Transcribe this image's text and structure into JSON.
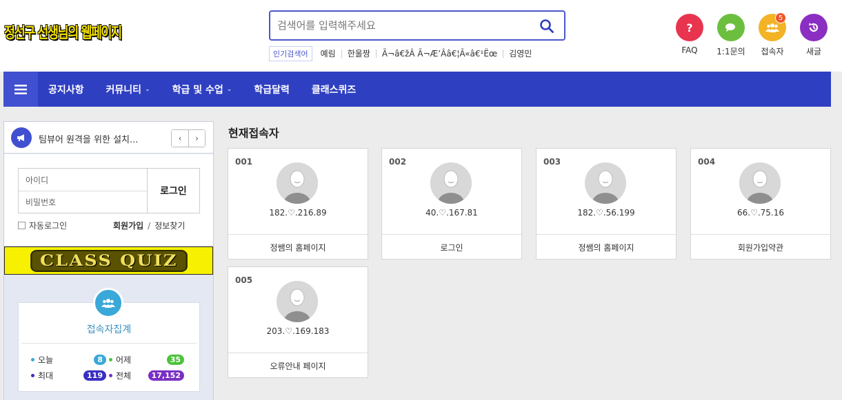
{
  "header": {
    "logo_text": "정선구 선생님의 웹페이지",
    "search": {
      "placeholder": "검색어를 입력해주세요"
    },
    "popular": {
      "tag_label": "인기검색어",
      "keywords": [
        "예림",
        "한울짱",
        "Ã¬â€žÂ Ã¬Æ’Ââ€¦Ã«â€¹Ëœ",
        "김영민"
      ]
    },
    "icons": [
      {
        "label": "FAQ",
        "icon": "question-icon",
        "color": "#e8344f"
      },
      {
        "label": "1:1문의",
        "icon": "chat-icon",
        "color": "#6cbf3e"
      },
      {
        "label": "접속자",
        "icon": "users-icon",
        "color": "#f3b325",
        "badge": "5"
      },
      {
        "label": "새글",
        "icon": "refresh-icon",
        "color": "#8a2fc2"
      }
    ]
  },
  "nav": {
    "items": [
      {
        "label": "공지사항",
        "dropdown": false
      },
      {
        "label": "커뮤니티",
        "dropdown": true
      },
      {
        "label": "학급 및 수업",
        "dropdown": true
      },
      {
        "label": "학급달력",
        "dropdown": false
      },
      {
        "label": "클래스퀴즈",
        "dropdown": false
      }
    ]
  },
  "sidebar": {
    "notice_text": "팀뷰어 원격을 위한 설치...",
    "login": {
      "id_placeholder": "아이디",
      "pw_placeholder": "비밀번호",
      "login_button": "로그인",
      "auto_login": "자동로그인",
      "join": "회원가입",
      "separator": "/",
      "find": "정보찾기"
    },
    "quiz_banner": "CLASS QUIZ",
    "stats": {
      "title": "접속자집계",
      "today_label": "오늘",
      "today_value": "8",
      "yesterday_label": "어제",
      "yesterday_value": "35",
      "max_label": "최대",
      "max_value": "119",
      "total_label": "전체",
      "total_value": "17,152"
    }
  },
  "main": {
    "title": "현재접속자",
    "visitors": [
      {
        "num": "001",
        "ip": "182.♡.216.89",
        "page": "정쌤의 홈페이지"
      },
      {
        "num": "002",
        "ip": "40.♡.167.81",
        "page": "로그인"
      },
      {
        "num": "003",
        "ip": "182.♡.56.199",
        "page": "정쌤의 홈페이지"
      },
      {
        "num": "004",
        "ip": "66.♡.75.16",
        "page": "회원가입약관"
      },
      {
        "num": "005",
        "ip": "203.♡.169.183",
        "page": "오류안내 페이지"
      }
    ]
  },
  "colors": {
    "nav_bg": "#2f3fc2",
    "accent": "#4a56c8"
  }
}
